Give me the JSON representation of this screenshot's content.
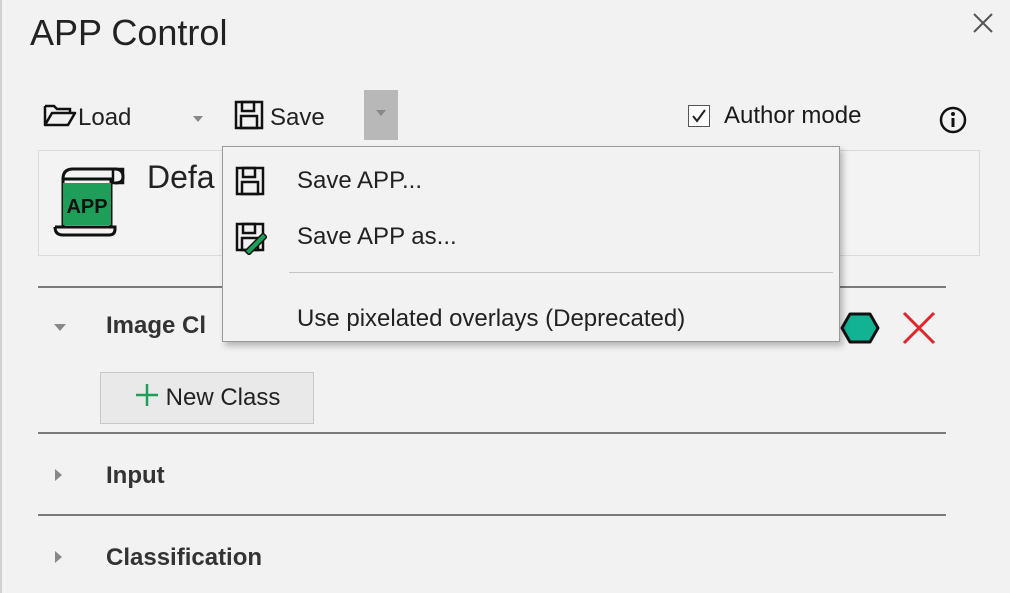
{
  "panel": {
    "title": "APP Control"
  },
  "toolbar": {
    "load_label": "Load",
    "save_label": "Save",
    "author_mode_label": "Author mode",
    "author_mode_checked": true
  },
  "app": {
    "icon_text": "APP",
    "name": "Defa"
  },
  "save_menu": {
    "items": [
      {
        "label": "Save APP..."
      },
      {
        "label": "Save APP as..."
      },
      {
        "label": "Use pixelated overlays (Deprecated)"
      }
    ]
  },
  "sections": {
    "image_classes": {
      "label": "Image Cl",
      "expanded": true
    },
    "new_class_label": "New Class",
    "input": {
      "label": "Input",
      "expanded": false
    },
    "classification": {
      "label": "Classification",
      "expanded": false
    }
  },
  "colors": {
    "accent_green": "#1f9e5a",
    "hex_teal": "#12b394",
    "delete_red": "#e0262b"
  },
  "icons": {
    "close": "close-icon",
    "load": "folder-open-icon",
    "save": "floppy-disk-icon",
    "save_as": "floppy-pen-icon",
    "info": "info-icon",
    "app": "app-scroll-icon",
    "add": "plus-icon",
    "hexagon": "hexagon-icon",
    "delete": "x-icon"
  }
}
